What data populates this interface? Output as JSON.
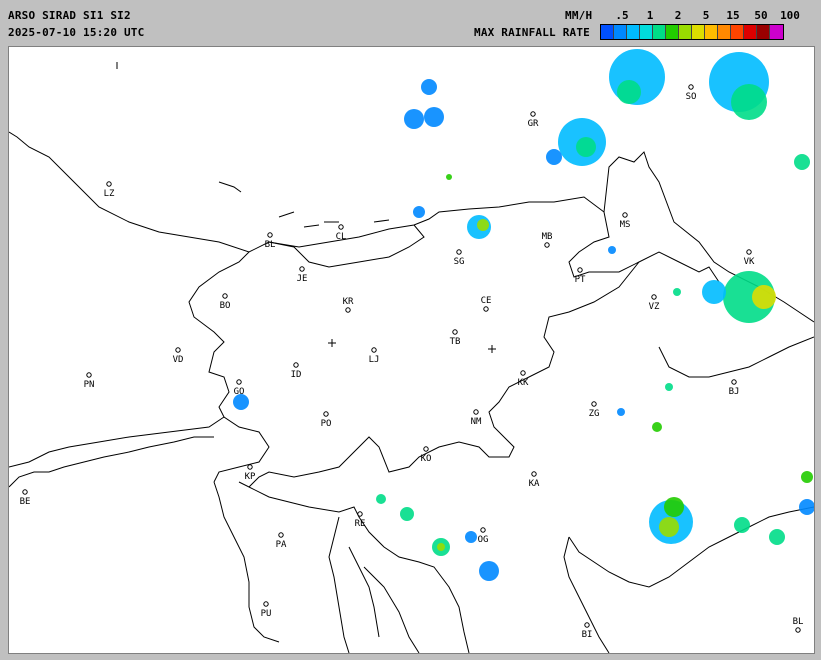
{
  "header": {
    "title": "ARSO SIRAD SI1 SI2",
    "timestamp": "2025-07-10 15:20 UTC",
    "unit": "MM/H",
    "legend_title": "MAX RAINFALL RATE"
  },
  "legend": {
    "ticks": [
      ".5",
      "1",
      "2",
      "5",
      "15",
      "50",
      "100"
    ],
    "colors": [
      "#0050ff",
      "#0088ff",
      "#00bbff",
      "#00dddd",
      "#00dd88",
      "#22cc00",
      "#99dd00",
      "#dddd00",
      "#ffbb00",
      "#ff8800",
      "#ff4400",
      "#dd0000",
      "#990000",
      "#cc00cc"
    ]
  },
  "map": {
    "cities": [
      {
        "code": "GR",
        "name_hidden": ""
      },
      {
        "code": "SO"
      },
      {
        "code": "LZ"
      },
      {
        "code": "BL"
      },
      {
        "code": "CL"
      },
      {
        "code": "SG"
      },
      {
        "code": "MB"
      },
      {
        "code": "MS"
      },
      {
        "code": "VK"
      },
      {
        "code": "JE"
      },
      {
        "code": "BO"
      },
      {
        "code": "KR"
      },
      {
        "code": "CE"
      },
      {
        "code": "PT"
      },
      {
        "code": "VZ"
      },
      {
        "code": "VD"
      },
      {
        "code": "TB"
      },
      {
        "code": "LJ"
      },
      {
        "code": "PN"
      },
      {
        "code": "GO"
      },
      {
        "code": "ID"
      },
      {
        "code": "KK"
      },
      {
        "code": "BJ"
      },
      {
        "code": "ZG"
      },
      {
        "code": "PO"
      },
      {
        "code": "NM"
      },
      {
        "code": "KO"
      },
      {
        "code": "KP"
      },
      {
        "code": "KA"
      },
      {
        "code": "BE"
      },
      {
        "code": "RE"
      },
      {
        "code": "OG"
      },
      {
        "code": "PA"
      },
      {
        "code": "PU"
      },
      {
        "code": "BI"
      },
      {
        "code": "BL"
      }
    ]
  }
}
